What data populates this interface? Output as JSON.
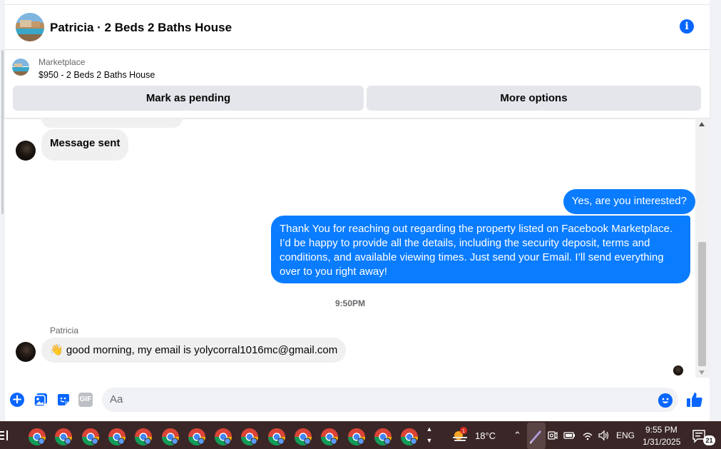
{
  "header": {
    "title": "Patricia · 2 Beds 2 Baths House",
    "info_icon": "info-circle-icon"
  },
  "marketplace": {
    "label": "Marketplace",
    "listing": "$950 - 2 Beds 2 Baths House",
    "mark_pending_label": "Mark as pending",
    "more_options_label": "More options"
  },
  "messages": {
    "incoming_1": "Message sent",
    "outgoing_1": "Yes, are you interested?",
    "outgoing_2": "Thank You for reaching out regarding the property listed on Facebook Marketplace. I’d be happy to provide all the details, including the security deposit, terms and conditions, and available viewing times. Just send your Email. I’ll send everything over to you right away!",
    "timestamp": "9:50PM",
    "sender_name": "Patricia",
    "incoming_2_emoji": "👋",
    "incoming_2": "good morning, my email is yolycorral1016mc@gmail.com"
  },
  "composer": {
    "placeholder": "Aa",
    "gif_label": "GIF",
    "icons": [
      "plus-icon",
      "photo-icon",
      "sticker-icon",
      "gif-icon",
      "emoji-icon",
      "like-icon"
    ]
  },
  "taskbar": {
    "weather_badge": "1",
    "temperature": "18°C",
    "language": "ENG",
    "time": "9:55 PM",
    "date": "1/31/2025",
    "notification_count": "21"
  },
  "colors": {
    "accent": "#0866ff",
    "outgoing_bubble": "#0a7cff",
    "incoming_bubble": "#f0f0f0",
    "taskbar": "#3a2626"
  }
}
